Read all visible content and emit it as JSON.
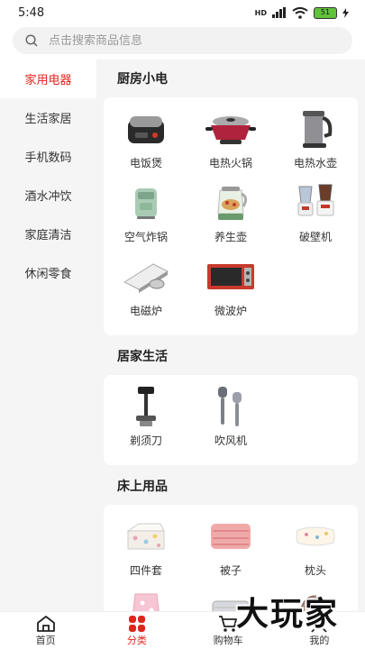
{
  "status": {
    "time": "5:48",
    "network": "HD",
    "battery": "51"
  },
  "search": {
    "placeholder": "点击搜索商品信息",
    "icon": "search-icon"
  },
  "sidebar": {
    "items": [
      {
        "label": "家用电器",
        "active": true
      },
      {
        "label": "生活家居",
        "active": false
      },
      {
        "label": "手机数码",
        "active": false
      },
      {
        "label": "酒水冲饮",
        "active": false
      },
      {
        "label": "家庭清洁",
        "active": false
      },
      {
        "label": "休闲零食",
        "active": false
      }
    ]
  },
  "sections": [
    {
      "title": "厨房小电",
      "products": [
        {
          "label": "电饭煲",
          "icon": "rice-cooker"
        },
        {
          "label": "电热火锅",
          "icon": "hot-pot"
        },
        {
          "label": "电热水壶",
          "icon": "kettle"
        },
        {
          "label": "空气炸锅",
          "icon": "air-fryer"
        },
        {
          "label": "养生壶",
          "icon": "health-pot"
        },
        {
          "label": "破壁机",
          "icon": "blender"
        },
        {
          "label": "电磁炉",
          "icon": "induction-cooker"
        },
        {
          "label": "微波炉",
          "icon": "microwave"
        }
      ]
    },
    {
      "title": "居家生活",
      "products": [
        {
          "label": "剃须刀",
          "icon": "razor"
        },
        {
          "label": "吹风机",
          "icon": "hair-dryer"
        }
      ]
    },
    {
      "title": "床上用品",
      "products": [
        {
          "label": "四件套",
          "icon": "bedding-set"
        },
        {
          "label": "被子",
          "icon": "quilt"
        },
        {
          "label": "枕头",
          "icon": "pillow"
        },
        {
          "label": "",
          "icon": "blanket"
        },
        {
          "label": "",
          "icon": "electric-blanket"
        },
        {
          "label": "",
          "icon": "mosquito-net"
        }
      ]
    }
  ],
  "nav": {
    "items": [
      {
        "label": "首页",
        "icon": "home-icon",
        "active": false
      },
      {
        "label": "分类",
        "icon": "category-icon",
        "active": true
      },
      {
        "label": "购物车",
        "icon": "cart-icon",
        "active": false
      },
      {
        "label": "我的",
        "icon": "profile-icon",
        "active": false
      }
    ]
  },
  "watermark": "大玩家",
  "colors": {
    "accent": "#e0251c",
    "background": "#f5f5f5"
  }
}
